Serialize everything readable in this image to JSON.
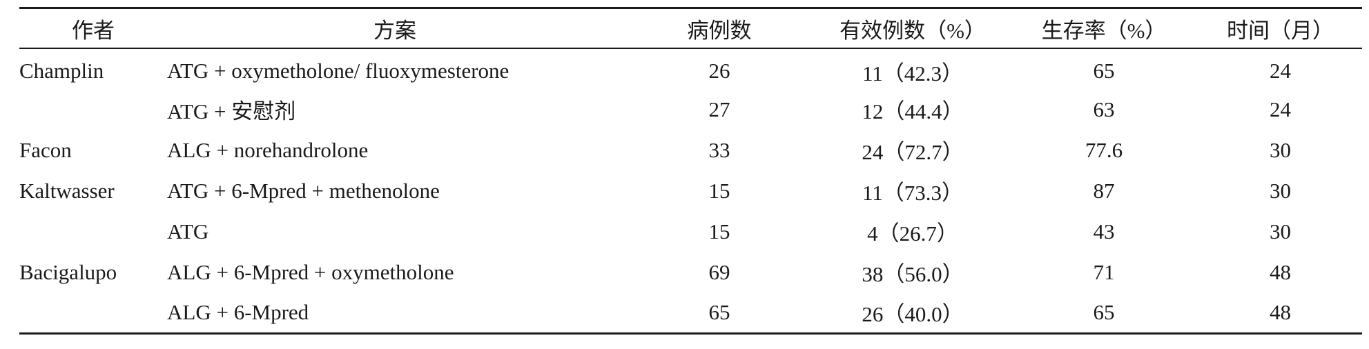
{
  "table": {
    "headers": {
      "author": "作者",
      "scheme": "方案",
      "cases": "病例数",
      "effective": "有效例数（%）",
      "survival": "生存率（%）",
      "time": "时间（月）"
    },
    "rows": [
      {
        "author": "Champlin",
        "scheme": "ATG + oxymetholone/ fluoxymesterone",
        "cases": "26",
        "effective": "11（42.3）",
        "survival": "65",
        "time": "24"
      },
      {
        "author": "",
        "scheme": "ATG + 安慰剂",
        "cases": "27",
        "effective": "12（44.4）",
        "survival": "63",
        "time": "24"
      },
      {
        "author": "Facon",
        "scheme": "ALG + norehandrolone",
        "cases": "33",
        "effective": "24（72.7）",
        "survival": "77.6",
        "time": "30"
      },
      {
        "author": "Kaltwasser",
        "scheme": "ATG + 6-Mpred + methenolone",
        "cases": "15",
        "effective": "11（73.3）",
        "survival": "87",
        "time": "30"
      },
      {
        "author": "",
        "scheme": "ATG",
        "cases": "15",
        "effective": "4（26.7）",
        "survival": "43",
        "time": "30"
      },
      {
        "author": "Bacigalupo",
        "scheme": "ALG + 6-Mpred + oxymetholone",
        "cases": "69",
        "effective": "38（56.0）",
        "survival": "71",
        "time": "48"
      },
      {
        "author": "",
        "scheme": "ALG + 6-Mpred",
        "cases": "65",
        "effective": "26（40.0）",
        "survival": "65",
        "time": "48"
      }
    ]
  }
}
